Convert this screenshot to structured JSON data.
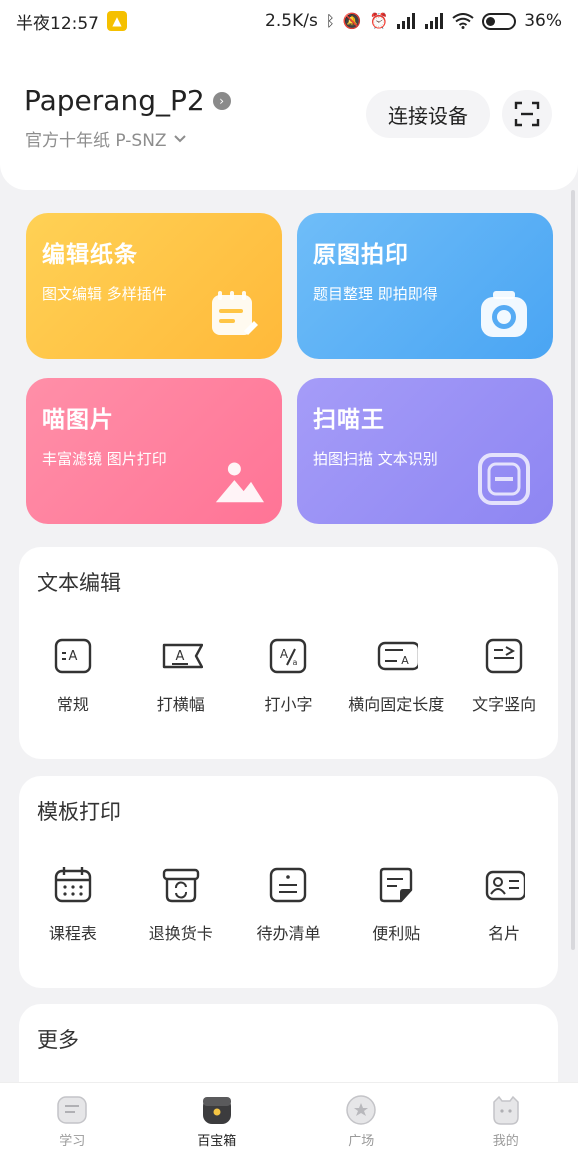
{
  "status_bar": {
    "time": "半夜12:57",
    "speed": "2.5K/s",
    "battery": "36%",
    "battery_level": 0.36
  },
  "header": {
    "device_name": "Paperang_P2",
    "paper_type": "官方十年纸 P-SNZ",
    "connect_label": "连接设备"
  },
  "features": [
    {
      "title": "编辑纸条",
      "subtitle": "图文编辑 多样插件",
      "icon": "note-edit-icon"
    },
    {
      "title": "原图拍印",
      "subtitle": "题目整理 即拍即得",
      "icon": "camera-icon"
    },
    {
      "title": "喵图片",
      "subtitle": "丰富滤镜 图片打印",
      "icon": "image-icon"
    },
    {
      "title": "扫喵王",
      "subtitle": "拍图扫描 文本识别",
      "icon": "scan-icon"
    }
  ],
  "text_edit": {
    "title": "文本编辑",
    "items": [
      {
        "label": "常规",
        "icon": "text-normal-icon"
      },
      {
        "label": "打横幅",
        "icon": "banner-icon"
      },
      {
        "label": "打小字",
        "icon": "small-text-icon"
      },
      {
        "label": "横向固定长度",
        "icon": "fixed-length-icon"
      },
      {
        "label": "文字竖向",
        "icon": "vertical-text-icon"
      }
    ]
  },
  "template_print": {
    "title": "模板打印",
    "items": [
      {
        "label": "课程表",
        "icon": "calendar-icon"
      },
      {
        "label": "退换货卡",
        "icon": "return-box-icon"
      },
      {
        "label": "待办清单",
        "icon": "todo-list-icon"
      },
      {
        "label": "便利贴",
        "icon": "sticky-note-icon"
      },
      {
        "label": "名片",
        "icon": "business-card-icon"
      }
    ]
  },
  "more": {
    "title": "更多"
  },
  "tabs": [
    {
      "label": "学习",
      "icon": "study-icon",
      "active": false
    },
    {
      "label": "百宝箱",
      "icon": "toolbox-icon",
      "active": true
    },
    {
      "label": "广场",
      "icon": "plaza-icon",
      "active": false
    },
    {
      "label": "我的",
      "icon": "profile-cat-icon",
      "active": false
    }
  ]
}
